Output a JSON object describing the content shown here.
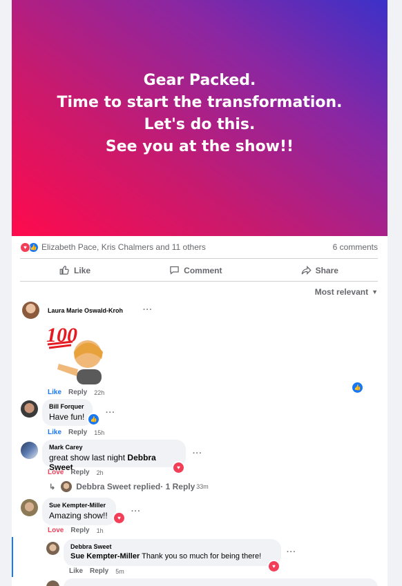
{
  "post": {
    "banner_lines": [
      "Gear Packed.",
      "Time to start the transformation.",
      "Let's do this.",
      "See you at the show!!"
    ],
    "colors": {
      "gradient_start": "#ff0a4c",
      "gradient_end": "#3b31c9"
    }
  },
  "stats": {
    "reactors": "Elizabeth Pace, Kris Chalmers and 11 others",
    "comments_count": "6 comments"
  },
  "actions": {
    "like": "Like",
    "comment": "Comment",
    "share": "Share"
  },
  "sort": {
    "label": "Most relevant"
  },
  "comments": [
    {
      "author": "Laura Marie Oswald-Kroh",
      "text": "",
      "sticker": "100-emoji-sticker",
      "like": "Like",
      "reply": "Reply",
      "time": "22h",
      "reaction": "like"
    },
    {
      "author": "Bill Forquer",
      "text": "Have fun!",
      "like": "Like",
      "reply": "Reply",
      "time": "15h",
      "reaction": "like"
    },
    {
      "author": "Mark Carey",
      "text": "great show last night",
      "mention": "Debbra Sweet",
      "like": "Love",
      "reply": "Reply",
      "time": "2h",
      "reaction": "love",
      "replies_link": {
        "name": "Debbra Sweet replied",
        "count": " · 1 Reply",
        "time": "33m"
      }
    },
    {
      "author": "Sue Kempter-Miller",
      "text": "Amazing show!!",
      "like": "Love",
      "reply": "Reply",
      "time": "1h",
      "reaction": "love"
    }
  ],
  "reply": {
    "author": "Debbra Sweet",
    "mention": "Sue Kempter-Miller",
    "text": " Thank you so much for being there!",
    "like": "Like",
    "reply": "Reply",
    "time": "5m",
    "reaction": "love"
  },
  "more_dots": "···"
}
